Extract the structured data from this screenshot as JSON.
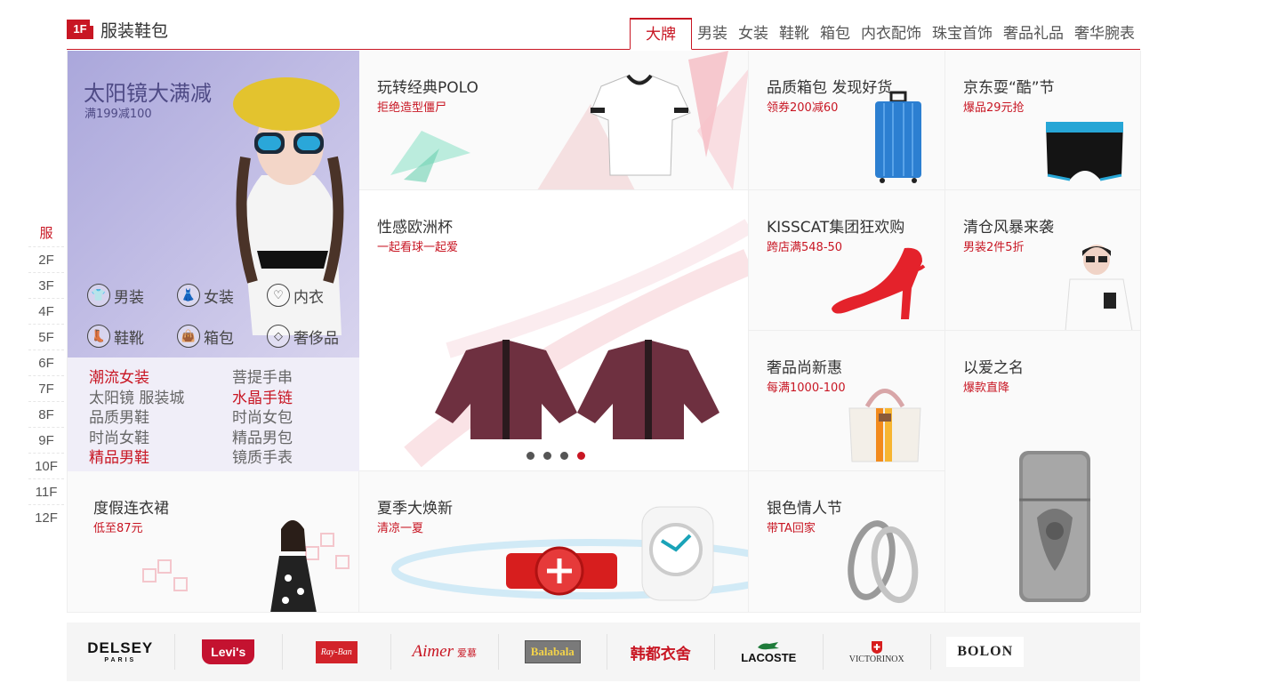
{
  "elevator": {
    "items": [
      {
        "label": "服",
        "current": true
      },
      {
        "label": "2F"
      },
      {
        "label": "3F"
      },
      {
        "label": "4F"
      },
      {
        "label": "5F"
      },
      {
        "label": "6F"
      },
      {
        "label": "7F"
      },
      {
        "label": "8F"
      },
      {
        "label": "9F"
      },
      {
        "label": "10F"
      },
      {
        "label": "11F"
      },
      {
        "label": "12F"
      }
    ]
  },
  "floor": {
    "badge": "1F",
    "title": "服装鞋包",
    "tabs": [
      "大牌",
      "男装",
      "女装",
      "鞋靴",
      "箱包",
      "内衣配饰",
      "珠宝首饰",
      "奢品礼品",
      "奢华腕表"
    ],
    "active_tab": 0
  },
  "left_promo": {
    "title": "太阳镜大满减",
    "subtitle": "满199减100",
    "categories": [
      {
        "label": "男装",
        "icon": "tshirt-icon",
        "glyph": "👕"
      },
      {
        "label": "女装",
        "icon": "dress-icon",
        "glyph": "👗"
      },
      {
        "label": "内衣",
        "icon": "bra-icon",
        "glyph": "♡"
      },
      {
        "label": "鞋靴",
        "icon": "boot-icon",
        "glyph": "👢"
      },
      {
        "label": "箱包",
        "icon": "bag-icon",
        "glyph": "👜"
      },
      {
        "label": "奢侈品",
        "icon": "diamond-icon",
        "glyph": "◇"
      }
    ],
    "hot_words_left": [
      {
        "text": "潮流女装",
        "red": true
      },
      {
        "text": "太阳镜  服装城",
        "red": false
      },
      {
        "text": "品质男鞋",
        "red": false
      },
      {
        "text": "时尚女鞋",
        "red": false
      },
      {
        "text": "精品男鞋",
        "red": true
      }
    ],
    "hot_words_right": [
      {
        "text": "菩提手串",
        "red": false
      },
      {
        "text": "水晶手链",
        "red": true
      },
      {
        "text": "时尚女包",
        "red": false
      },
      {
        "text": "精品男包",
        "red": false
      },
      {
        "text": "镜质手表",
        "red": false
      }
    ]
  },
  "cells": {
    "polo": {
      "title": "玩转经典POLO",
      "sub": "拒绝造型僵尸"
    },
    "euro": {
      "title": "性感欧洲杯",
      "sub": "一起看球一起爱"
    },
    "luggage": {
      "title": "品质箱包 发现好货",
      "sub": "领券200减60"
    },
    "cool": {
      "title": "京东耍“酷”节",
      "sub": "爆品29元抢"
    },
    "kisscat": {
      "title": "KISSCAT集团狂欢购",
      "sub": "跨店满548-50"
    },
    "clearance": {
      "title": "清仓风暴来袭",
      "sub": "男装2件5折"
    },
    "luxury": {
      "title": "奢品尚新惠",
      "sub": "每满1000-100"
    },
    "love": {
      "title": "以爱之名",
      "sub": "爆款直降"
    },
    "dress": {
      "title": "度假连衣裙",
      "sub": "低至87元"
    },
    "summer": {
      "title": "夏季大焕新",
      "sub": "清凉一夏"
    },
    "silver": {
      "title": "银色情人节",
      "sub": "带TA回家"
    }
  },
  "slider": {
    "count": 4,
    "active_index": 3
  },
  "brands": {
    "delsey": "DELSEY",
    "delsey_sub": "PARIS",
    "levis": "Levi's",
    "rayban": "Ray-Ban",
    "aimer": "Aimer",
    "aimer_cn": "爱慕",
    "balabala": "Balabala",
    "handu": "韩都衣舍",
    "lacoste": "LACOSTE",
    "victorinox": "VICTORINOX",
    "bolon": "BOLON"
  },
  "colors": {
    "accent": "#c81623",
    "promo_bg": "#b8b3dd"
  }
}
